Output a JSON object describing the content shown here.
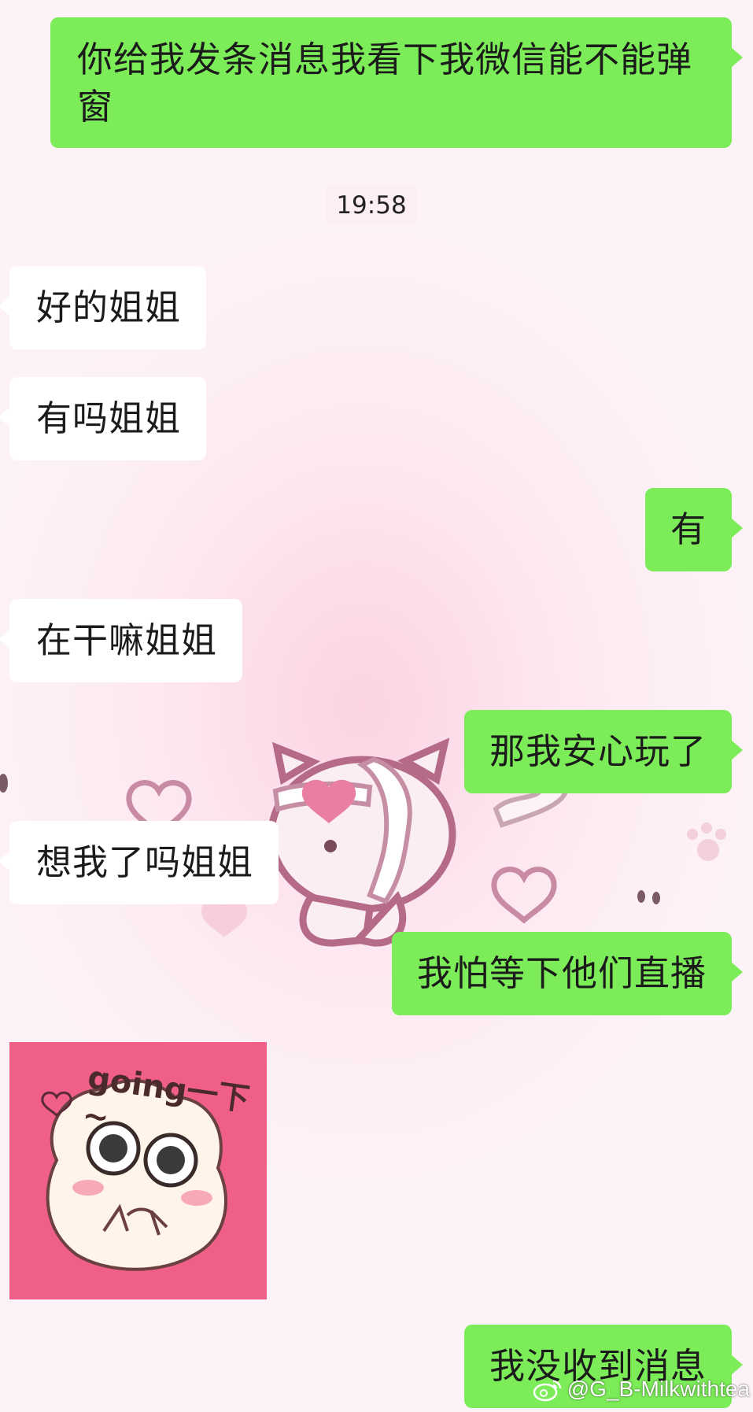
{
  "messages": [
    {
      "side": "out",
      "text": "你给我发条消息我看下我微信能不能弹窗"
    },
    {
      "side": "in",
      "text": "好的姐姐"
    },
    {
      "side": "in",
      "text": "有吗姐姐"
    },
    {
      "side": "out",
      "text": "有"
    },
    {
      "side": "in",
      "text": "在干嘛姐姐"
    },
    {
      "side": "out",
      "text": "那我安心玩了"
    },
    {
      "side": "in",
      "text": "想我了吗姐姐"
    },
    {
      "side": "out",
      "text": "我怕等下他们直播"
    },
    {
      "side": "out",
      "text": "我没收到消息"
    }
  ],
  "timestamp": "19:58",
  "sticker": {
    "caption": "going一下~"
  },
  "watermark": {
    "icon": "weibo-icon",
    "handle": "@G_B-Milkwithtea"
  },
  "colors": {
    "outgoing_bubble": "#7ced58",
    "incoming_bubble": "#ffffff",
    "background": "#fde6ef"
  }
}
